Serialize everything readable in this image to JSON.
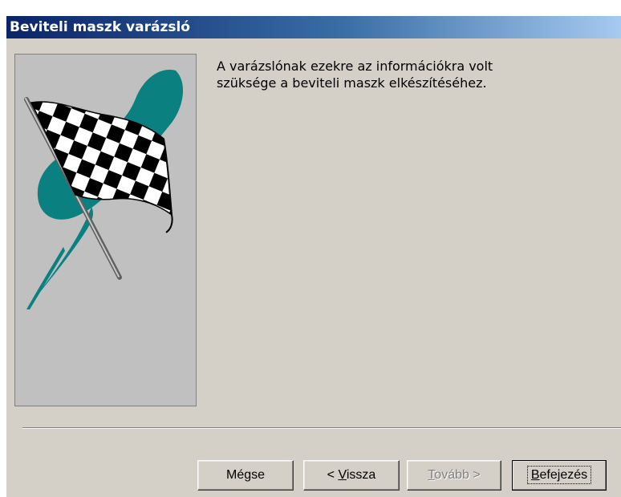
{
  "window": {
    "title": "Beviteli maszk varázsló"
  },
  "message": {
    "line1": "A varázslónak ezekre az információkra volt",
    "line2": "szüksége a beviteli maszk elkészítéséhez."
  },
  "buttons": {
    "cancel": {
      "label": "Mégse"
    },
    "back": {
      "prefix": "< ",
      "accel": "V",
      "rest": "issza"
    },
    "next": {
      "accel": "T",
      "rest": "ovább >",
      "disabled": true
    },
    "finish": {
      "accel": "B",
      "rest": "efejezés"
    }
  },
  "image": {
    "icon": "checkered-finish-flag",
    "colors": {
      "background": "#c0c0c0",
      "swoosh": "#008080",
      "pole": "#a0a0a0"
    }
  }
}
